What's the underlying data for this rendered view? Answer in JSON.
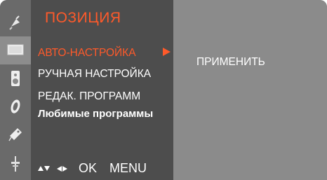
{
  "menu": {
    "title": "ПОЗИЦИЯ",
    "items": [
      {
        "label": "АВТО-НАСТРОЙКА",
        "selected": true
      },
      {
        "label": "РУЧНАЯ НАСТРОЙКА",
        "selected": false
      },
      {
        "label": "РЕДАК. ПРОГРАММ",
        "selected": false
      },
      {
        "label": "Любимые программы",
        "selected": false
      }
    ]
  },
  "hints": {
    "ok": "OK",
    "menu": "MENU"
  },
  "info": {
    "apply": "ПРИМЕНИТЬ"
  },
  "rail": {
    "icons": [
      "satellite-icon",
      "screen-icon",
      "audio-icon",
      "clock-icon",
      "tag-icon",
      "plug-icon"
    ],
    "active_index": 1
  },
  "colors": {
    "accent": "#ff5a2a",
    "panel": "#4d4d4d",
    "rail": "#6a6a6a",
    "background": "#8b8b8b"
  }
}
